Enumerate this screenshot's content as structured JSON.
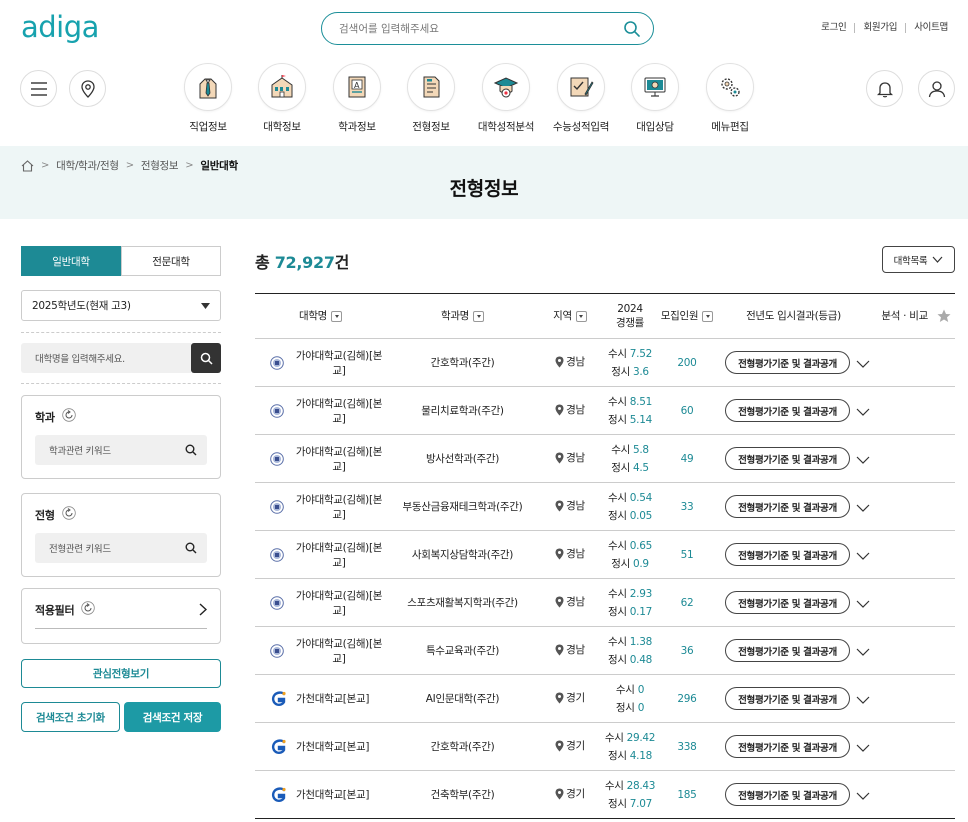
{
  "header": {
    "logo": "adiga",
    "search_placeholder": "검색어를 입력해주세요",
    "links": [
      "로그인",
      "회원가입",
      "사이트맵"
    ]
  },
  "nav": {
    "menus": [
      "직업정보",
      "대학정보",
      "학과정보",
      "전형정보",
      "대학성적분석",
      "수능성적입력",
      "대입상담",
      "메뉴편집"
    ]
  },
  "breadcrumb": [
    "대학/학과/전형",
    "전형정보",
    "일반대학"
  ],
  "page_title": "전형정보",
  "sidebar": {
    "tabs": [
      "일반대학",
      "전문대학"
    ],
    "year_select": "2025학년도(현재 고3)",
    "uni_search_placeholder": "대학명을 입력해주세요.",
    "major_title": "학과",
    "major_placeholder": "학과관련 키워드",
    "admission_title": "전형",
    "admission_placeholder": "전형관련 키워드",
    "filter_title": "적용필터",
    "interest_button": "관심전형보기",
    "reset_button": "검색조건 초기화",
    "save_button": "검색조건 저장"
  },
  "main": {
    "total_prefix": "총",
    "total_count": "72,927",
    "total_suffix": "건",
    "list_button": "대학목록",
    "columns": {
      "university": "대학명",
      "major": "학과명",
      "region": "지역",
      "competition_year": "2024",
      "competition": "경쟁률",
      "recruit": "모집인원",
      "result": "전년도 입시결과(등급)",
      "analysis": "분석 · 비교"
    },
    "rows": [
      {
        "university": "가야대학교(김해)[본교]",
        "major": "간호학과(주간)",
        "region": "경남",
        "susi": "7.52",
        "jeongsi": "3.6",
        "recruit": "200",
        "result": "전형평가기준 및 결과공개",
        "logo": "gaya"
      },
      {
        "university": "가야대학교(김해)[본교]",
        "major": "물리치료학과(주간)",
        "region": "경남",
        "susi": "8.51",
        "jeongsi": "5.14",
        "recruit": "60",
        "result": "전형평가기준 및 결과공개",
        "logo": "gaya"
      },
      {
        "university": "가야대학교(김해)[본교]",
        "major": "방사선학과(주간)",
        "region": "경남",
        "susi": "5.8",
        "jeongsi": "4.5",
        "recruit": "49",
        "result": "전형평가기준 및 결과공개",
        "logo": "gaya"
      },
      {
        "university": "가야대학교(김해)[본교]",
        "major": "부동산금융재테크학과(주간)",
        "region": "경남",
        "susi": "0.54",
        "jeongsi": "0.05",
        "recruit": "33",
        "result": "전형평가기준 및 결과공개",
        "logo": "gaya"
      },
      {
        "university": "가야대학교(김해)[본교]",
        "major": "사회복지상담학과(주간)",
        "region": "경남",
        "susi": "0.65",
        "jeongsi": "0.9",
        "recruit": "51",
        "result": "전형평가기준 및 결과공개",
        "logo": "gaya"
      },
      {
        "university": "가야대학교(김해)[본교]",
        "major": "스포츠재활복지학과(주간)",
        "region": "경남",
        "susi": "2.93",
        "jeongsi": "0.17",
        "recruit": "62",
        "result": "전형평가기준 및 결과공개",
        "logo": "gaya"
      },
      {
        "university": "가야대학교(김해)[본교]",
        "major": "특수교육과(주간)",
        "region": "경남",
        "susi": "1.38",
        "jeongsi": "0.48",
        "recruit": "36",
        "result": "전형평가기준 및 결과공개",
        "logo": "gaya"
      },
      {
        "university": "가천대학교[본교]",
        "major": "AI인문대학(주간)",
        "region": "경기",
        "susi": "0",
        "jeongsi": "0",
        "recruit": "296",
        "result": "전형평가기준 및 결과공개",
        "logo": "gachon"
      },
      {
        "university": "가천대학교[본교]",
        "major": "간호학과(주간)",
        "region": "경기",
        "susi": "29.42",
        "jeongsi": "4.18",
        "recruit": "338",
        "result": "전형평가기준 및 결과공개",
        "logo": "gachon"
      },
      {
        "university": "가천대학교[본교]",
        "major": "건축학부(주간)",
        "region": "경기",
        "susi": "28.43",
        "jeongsi": "7.07",
        "recruit": "185",
        "result": "전형평가기준 및 결과공개",
        "logo": "gachon"
      }
    ],
    "susi_label": "수시",
    "jeongsi_label": "정시"
  },
  "colors": {
    "accent": "#1d8a95",
    "hero_bg": "#eef6f6"
  }
}
